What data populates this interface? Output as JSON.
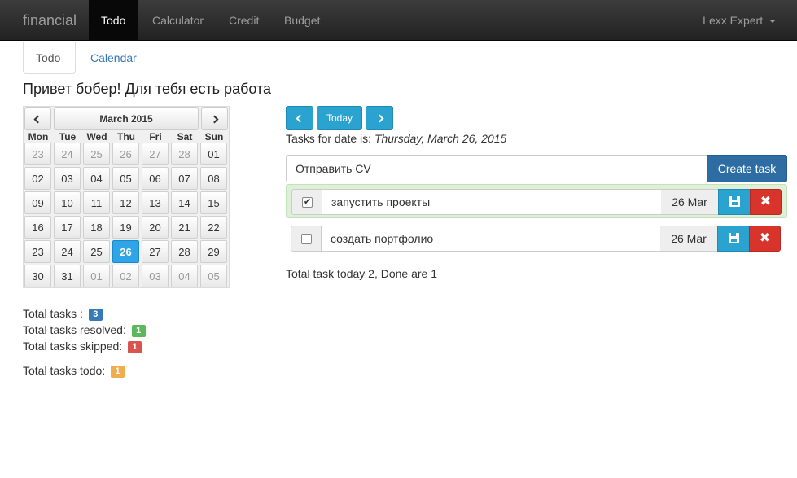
{
  "navbar": {
    "brand": "financial",
    "items": [
      {
        "label": "Todo",
        "active": true
      },
      {
        "label": "Calculator"
      },
      {
        "label": "Credit"
      },
      {
        "label": "Budget"
      }
    ],
    "user": "Lexx Expert"
  },
  "tabs": [
    {
      "label": "Todo",
      "active": true
    },
    {
      "label": "Calendar"
    }
  ],
  "greeting": "Привет бобер! Для тебя есть работа",
  "calendar": {
    "title": "March 2015",
    "weekdays": [
      "Mon",
      "Tue",
      "Wed",
      "Thu",
      "Fri",
      "Sat",
      "Sun"
    ],
    "days": [
      "23",
      "24",
      "25",
      "26",
      "27",
      "28",
      "01",
      "02",
      "03",
      "04",
      "05",
      "06",
      "07",
      "08",
      "09",
      "10",
      "11",
      "12",
      "13",
      "14",
      "15",
      "16",
      "17",
      "18",
      "19",
      "20",
      "21",
      "22",
      "23",
      "24",
      "25",
      "26",
      "27",
      "28",
      "29",
      "30",
      "31",
      "01",
      "02",
      "03",
      "04",
      "05"
    ],
    "muted": [
      0,
      1,
      2,
      3,
      4,
      5,
      37,
      38,
      39,
      40,
      41
    ],
    "selected_index": 31
  },
  "stats": {
    "total_label": "Total tasks :",
    "total": "3",
    "resolved_label": "Total tasks resolved:",
    "resolved": "1",
    "skipped_label": "Total tasks skipped:",
    "skipped": "1",
    "todo_label": "Total tasks todo:",
    "todo": "1"
  },
  "controls": {
    "today": "Today",
    "date_prefix": "Tasks for date is:",
    "date_value": "Thursday, March 26, 2015",
    "new_task_value": "Отправить CV",
    "create_label": "Create task"
  },
  "tasks": [
    {
      "title": "запустить проекты",
      "date": "26 Mar",
      "done": true
    },
    {
      "title": "создать портфолио",
      "date": "26 Mar",
      "done": false
    }
  ],
  "summary": "Total task today 2, Done are 1",
  "colors": {
    "info": "#2aa3d0",
    "primary": "#2e6da4",
    "danger": "#d9342b",
    "success": "#5cb85c",
    "warning": "#f0ad4e",
    "badge_blue": "#337ab7",
    "today_blue": "#2fa4e7"
  }
}
